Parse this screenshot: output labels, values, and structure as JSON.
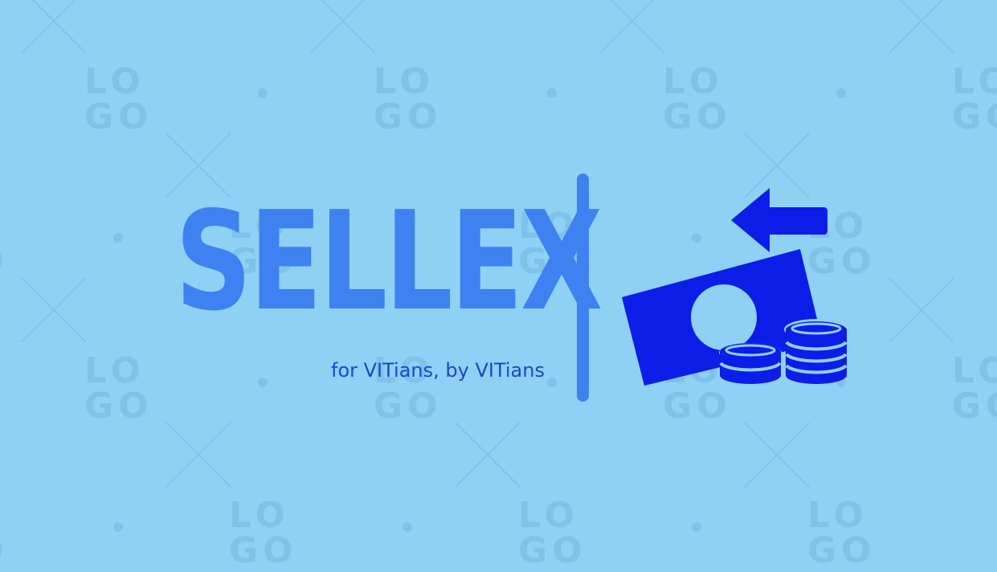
{
  "brand": {
    "name": "SELLEX",
    "tagline": "for VITians, by VITians"
  },
  "watermark": {
    "text": "LOGO"
  },
  "icons": {
    "main_icon": "money-transfer-icon",
    "arrow": "arrow-left-icon",
    "banknote": "banknote-icon",
    "coins": "coin-stack-icon"
  },
  "colors": {
    "background": "#8fd0f5",
    "brand_blue": "#3d82f0",
    "icon_blue": "#0d1de8"
  }
}
